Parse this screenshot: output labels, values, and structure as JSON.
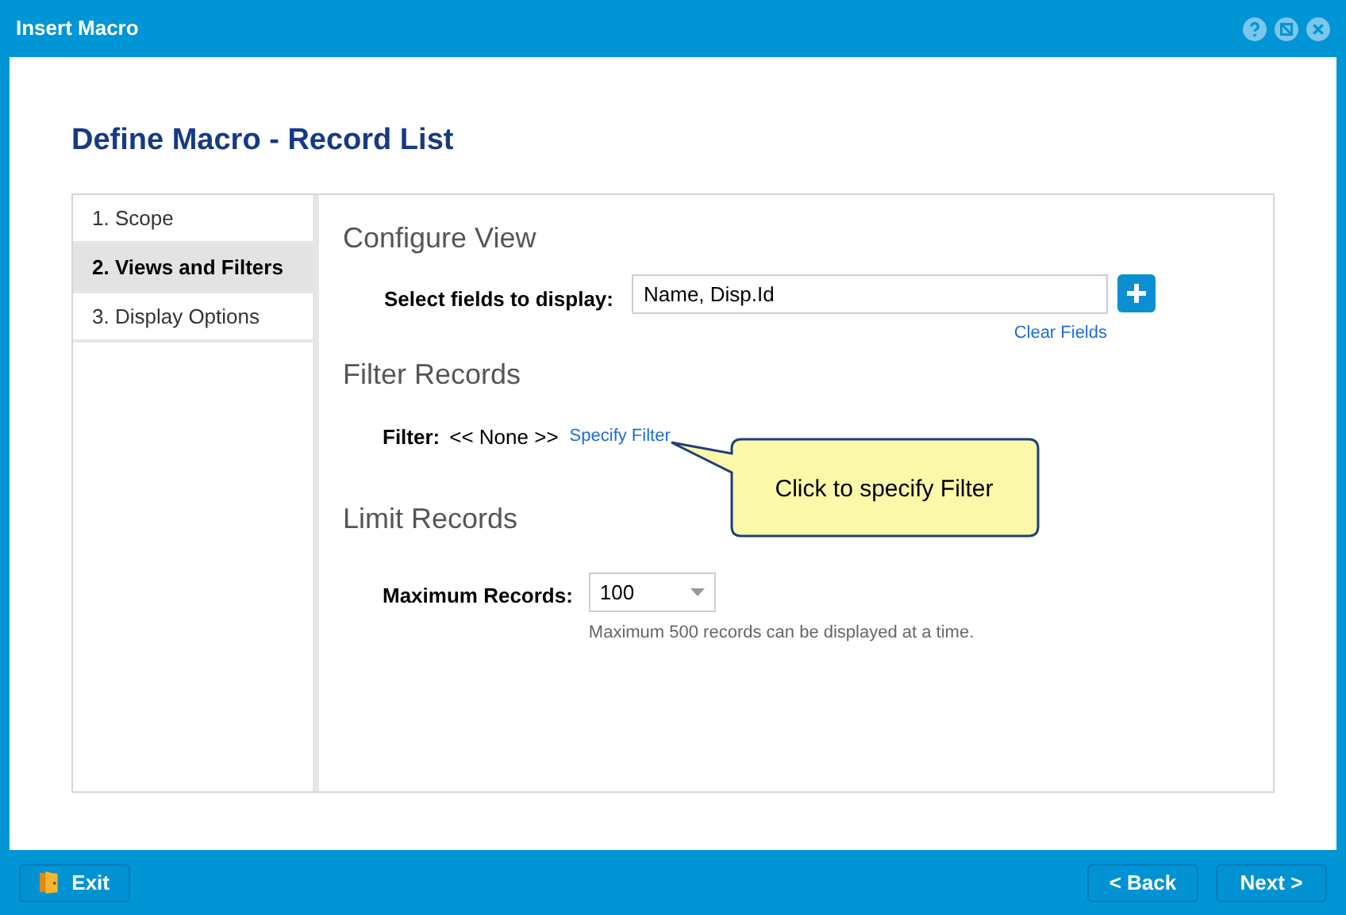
{
  "window": {
    "title": "Insert Macro"
  },
  "page_title": "Define Macro - Record List",
  "steps": [
    {
      "label": "1. Scope",
      "selected": false
    },
    {
      "label": "2. Views and Filters",
      "selected": true
    },
    {
      "label": "3. Display Options",
      "selected": false
    }
  ],
  "configure_view": {
    "heading": "Configure View",
    "label": "Select fields to display:",
    "value": "Name, Disp.Id",
    "clear_link": "Clear Fields"
  },
  "filter_records": {
    "heading": "Filter Records",
    "label": "Filter:",
    "value": "<< None >>",
    "link": "Specify Filter"
  },
  "callout": "Click to specify Filter",
  "limit_records": {
    "heading": "Limit Records",
    "label": "Maximum Records:",
    "value": "100",
    "hint": "Maximum 500 records can be displayed at a time."
  },
  "footer": {
    "exit": "Exit",
    "back": "< Back",
    "next": "Next >"
  }
}
